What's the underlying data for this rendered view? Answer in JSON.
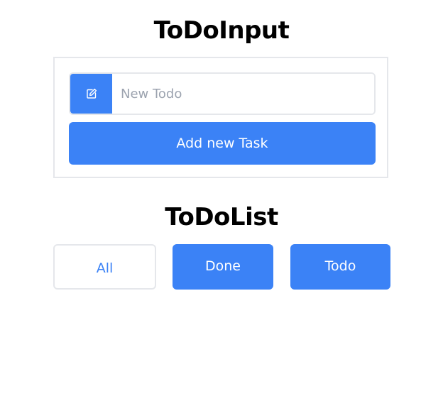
{
  "input_section": {
    "title": "ToDoInput",
    "input": {
      "placeholder": "New Todo",
      "value": "",
      "icon": "edit-icon"
    },
    "add_button_label": "Add new Task"
  },
  "list_section": {
    "title": "ToDoList",
    "filters": [
      {
        "label": "All",
        "style": "outline"
      },
      {
        "label": "Done",
        "style": "primary"
      },
      {
        "label": "Todo",
        "style": "primary"
      }
    ]
  },
  "colors": {
    "accent": "#3b82f6",
    "border": "#e5e7eb",
    "placeholder": "#9ca3af"
  }
}
